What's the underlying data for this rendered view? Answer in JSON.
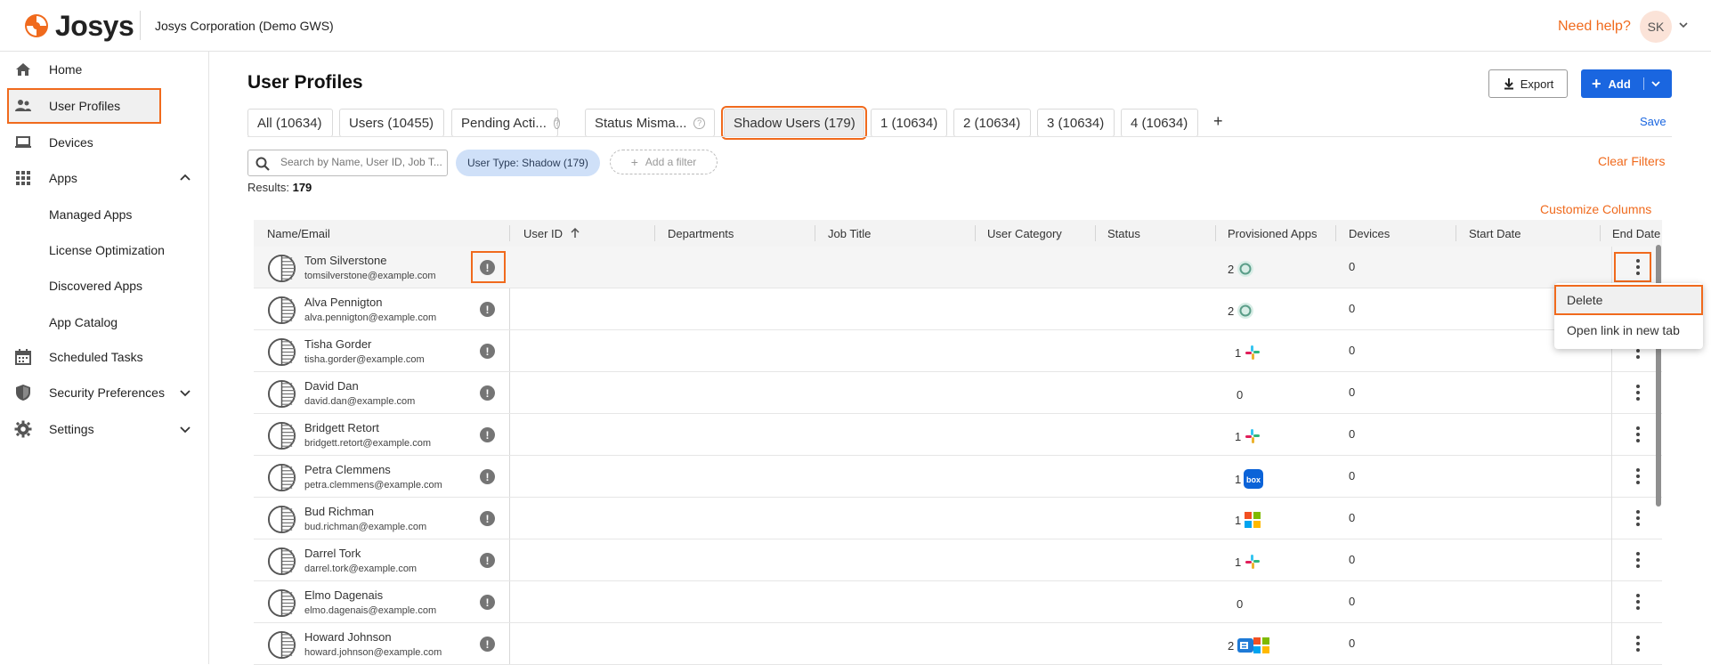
{
  "topbar": {
    "logo_text": "Josys",
    "org_name": "Josys Corporation (Demo GWS)",
    "help_label": "Need help?",
    "avatar_initials": "SK"
  },
  "sidebar": {
    "items": [
      {
        "label": "Home",
        "icon": "home-icon"
      },
      {
        "label": "User Profiles",
        "icon": "users-icon"
      },
      {
        "label": "Devices",
        "icon": "laptop-icon"
      },
      {
        "label": "Apps",
        "icon": "grid-icon"
      },
      {
        "label": "Scheduled Tasks",
        "icon": "calendar-icon"
      },
      {
        "label": "Security Preferences",
        "icon": "shield-icon"
      },
      {
        "label": "Settings",
        "icon": "gear-icon"
      }
    ],
    "apps_sub": [
      "Managed Apps",
      "License Optimization",
      "Discovered Apps",
      "App Catalog"
    ]
  },
  "main": {
    "title": "User Profiles",
    "export_label": "Export",
    "add_label": "Add",
    "save_label": "Save",
    "tabs": [
      {
        "label": "All (10634)"
      },
      {
        "label": "Users (10455)"
      },
      {
        "label": "Pending Acti..."
      },
      {
        "label": "Status Misma..."
      },
      {
        "label": "Shadow Users (179)"
      },
      {
        "label": "1 (10634)"
      },
      {
        "label": "2 (10634)"
      },
      {
        "label": "3 (10634)"
      },
      {
        "label": "4 (10634)"
      }
    ],
    "tab_add": "+",
    "search_placeholder": "Search by Name, User ID, Job T...",
    "filter_chip": "User Type: Shadow (179)",
    "add_filter": "Add a filter",
    "clear_filters": "Clear Filters",
    "results_label": "Results:",
    "results_count": "179",
    "customize_columns": "Customize Columns"
  },
  "table": {
    "columns": [
      "Name/Email",
      "User ID",
      "Departments",
      "Job Title",
      "User Category",
      "Status",
      "Provisioned Apps",
      "Devices",
      "Start Date",
      "End Date"
    ],
    "rows": [
      {
        "name": "Tom Silverstone",
        "email": "tomsilverstone@example.com",
        "prov": "2",
        "devices": "0"
      },
      {
        "name": "Alva Pennigton",
        "email": "alva.pennigton@example.com",
        "prov": "2",
        "devices": "0"
      },
      {
        "name": "Tisha Gorder",
        "email": "tisha.gorder@example.com",
        "prov": "1",
        "devices": "0"
      },
      {
        "name": "David Dan",
        "email": "david.dan@example.com",
        "prov": "0",
        "devices": "0"
      },
      {
        "name": "Bridgett Retort",
        "email": "bridgett.retort@example.com",
        "prov": "1",
        "devices": "0"
      },
      {
        "name": "Petra Clemmens",
        "email": "petra.clemmens@example.com",
        "prov": "1",
        "devices": "0"
      },
      {
        "name": "Bud Richman",
        "email": "bud.richman@example.com",
        "prov": "1",
        "devices": "0"
      },
      {
        "name": "Darrel Tork",
        "email": "darrel.tork@example.com",
        "prov": "1",
        "devices": "0"
      },
      {
        "name": "Elmo Dagenais",
        "email": "elmo.dagenais@example.com",
        "prov": "0",
        "devices": "0"
      },
      {
        "name": "Howard Johnson",
        "email": "howard.johnson@example.com",
        "prov": "2",
        "devices": "0"
      }
    ]
  },
  "context_menu": {
    "items": [
      "Delete",
      "Open link in new tab"
    ]
  }
}
